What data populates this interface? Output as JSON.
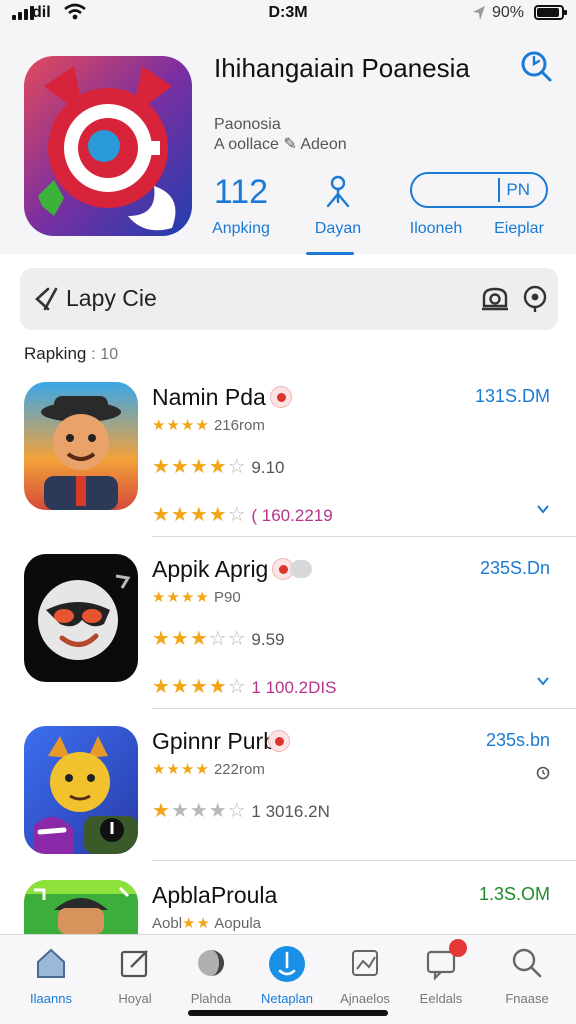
{
  "status": {
    "carrier": "dil",
    "time": "D:3M",
    "battery_pct": "90%",
    "battery_level": 0.9
  },
  "header": {
    "title": "Ihihangaiain Poanesia",
    "subtitle1": "Paonosia",
    "subtitle2": "A oollace ✎ Adeon",
    "stat1_value": "112",
    "stat1_label": "Anpking",
    "stat2_label": "Dayan",
    "stat3_label": "Ilooneh",
    "stat4_label": "Eieplar",
    "pill_text": "PN"
  },
  "search": {
    "text": "Lapy Cie"
  },
  "ranking": {
    "label": "Rapking",
    "separator": ":",
    "count": "10"
  },
  "apps": [
    {
      "name": "Namin Pda",
      "size": "131S.DM",
      "line1_stars": "★★★★",
      "line1_text": "216rom",
      "line2_stars_on": "★★★★",
      "line2_stars_off": "☆",
      "line2_text": "9.10",
      "line3_stars_on": "★★★★",
      "line3_stars_off": "☆",
      "line3_text": "( 160.2219",
      "line3_color": "#b5338a"
    },
    {
      "name": "Appik Aprig",
      "size": "235S.Dn",
      "line1_stars": "★★★★",
      "line1_text": "P90",
      "line2_stars_on": "★★★",
      "line2_stars_off": "☆☆",
      "line2_text": "9.59",
      "line3_stars_on": "★★★★",
      "line3_stars_off": "☆",
      "line3_text": "1 100.2DIS",
      "line3_color": "#b5338a"
    },
    {
      "name": "Gpinnr Purb",
      "size": "235s.bn",
      "line1_stars": "★★★★",
      "line1_text": "222rom",
      "line2_stars_on": "★",
      "line2_stars_off": "★★★☆",
      "line2_text": "1 3016.2N",
      "line3_stars_on": "",
      "line3_stars_off": "",
      "line3_text": "",
      "line3_color": "#b5338a"
    },
    {
      "name": "ApblaProula",
      "size": "1.3S.OM",
      "line1_stars": "★★",
      "line1_text": "Aobla",
      "line1_prefix": "Aobl",
      "line1_tail": "Aopula"
    }
  ],
  "tabs": [
    {
      "label": "Ilaanns",
      "icon": "home-icon"
    },
    {
      "label": "Hoyal",
      "icon": "edit-icon"
    },
    {
      "label": "Plahda",
      "icon": "moon-icon"
    },
    {
      "label": "Netaplan",
      "icon": "plan-icon"
    },
    {
      "label": "Ajnaelos",
      "icon": "chart-icon"
    },
    {
      "label": "Eeldals",
      "icon": "message-icon"
    },
    {
      "label": "Fnaase",
      "icon": "search-icon"
    }
  ],
  "colors": {
    "accent": "#1a7ad6",
    "star": "#f2a516",
    "size_green": "#1b8a2a",
    "magenta": "#b5338a"
  }
}
